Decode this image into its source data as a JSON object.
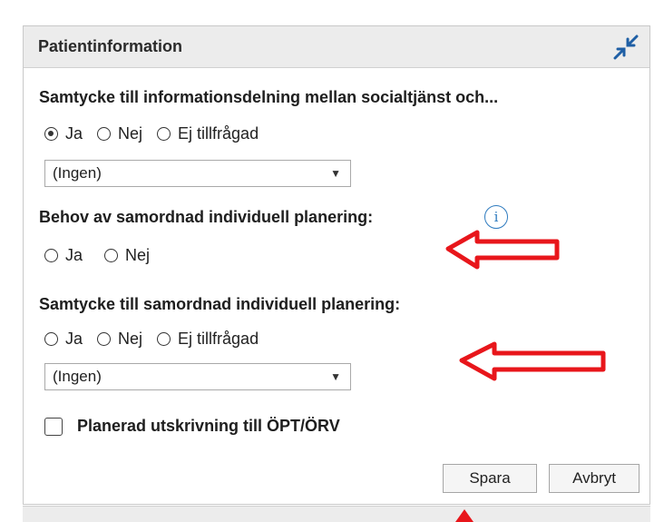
{
  "panel": {
    "title": "Patientinformation",
    "collapse_icon": "collapse-arrows-icon"
  },
  "sections": [
    {
      "label": "Samtycke till informationsdelning mellan socialtjänst och...",
      "options": [
        "Ja",
        "Nej",
        "Ej tillfrågad"
      ],
      "selected": "Ja",
      "dropdown": "(Ingen)"
    },
    {
      "label": "Behov av samordnad individuell planering:",
      "info_icon": "i",
      "options": [
        "Ja",
        "Nej"
      ],
      "selected": null
    },
    {
      "label": "Samtycke till samordnad individuell planering:",
      "options": [
        "Ja",
        "Nej",
        "Ej tillfrågad"
      ],
      "selected": null,
      "dropdown": "(Ingen)"
    }
  ],
  "checkbox": {
    "label": "Planerad utskrivning till ÖPT/ÖRV",
    "checked": false
  },
  "buttons": {
    "save": "Spara",
    "cancel": "Avbryt"
  },
  "colors": {
    "annotation_arrow": "#e8161b",
    "info": "#2e7bbf",
    "header_bg": "#ececec"
  }
}
